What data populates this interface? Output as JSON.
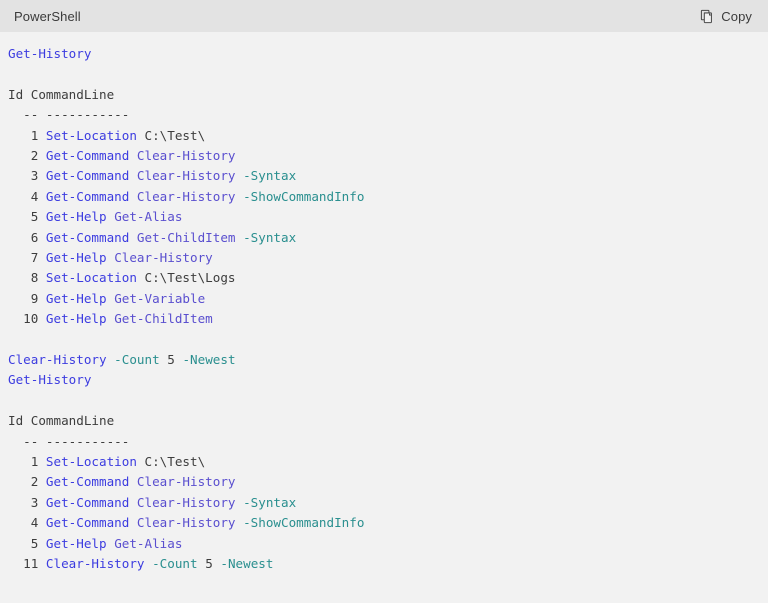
{
  "header": {
    "language_label": "PowerShell",
    "copy_label": "Copy",
    "copy_icon": "copy-pages-icon",
    "background_color": "#e3e3e3"
  },
  "code_block": {
    "background_color": "#f2f2f2",
    "colors": {
      "cmdlet": "#3c3ce0",
      "argument": "#5a4fcf",
      "parameter": "#2a8f8f",
      "plain": "#3d3d3d"
    },
    "lines": [
      {
        "id": "l1",
        "type": "command",
        "tokens": [
          {
            "t": "Get-History",
            "c": "cmdlet"
          }
        ]
      },
      {
        "id": "l2",
        "type": "blank",
        "tokens": []
      },
      {
        "id": "l3",
        "type": "output",
        "tokens": [
          {
            "t": "Id CommandLine",
            "c": "header"
          }
        ]
      },
      {
        "id": "l4",
        "type": "output",
        "tokens": [
          {
            "t": "  -- -----------",
            "c": "rule"
          }
        ]
      },
      {
        "id": "l5",
        "type": "output",
        "tokens": [
          {
            "t": "   1 ",
            "c": "num"
          },
          {
            "t": "Set-Location",
            "c": "cmdlet"
          },
          {
            "t": " ",
            "c": "plain"
          },
          {
            "t": "C:\\Test\\",
            "c": "plain"
          }
        ]
      },
      {
        "id": "l6",
        "type": "output",
        "tokens": [
          {
            "t": "   2 ",
            "c": "num"
          },
          {
            "t": "Get-Command",
            "c": "cmdlet"
          },
          {
            "t": " ",
            "c": "plain"
          },
          {
            "t": "Clear-History",
            "c": "argument"
          }
        ]
      },
      {
        "id": "l7",
        "type": "output",
        "tokens": [
          {
            "t": "   3 ",
            "c": "num"
          },
          {
            "t": "Get-Command",
            "c": "cmdlet"
          },
          {
            "t": " ",
            "c": "plain"
          },
          {
            "t": "Clear-History",
            "c": "argument"
          },
          {
            "t": " ",
            "c": "plain"
          },
          {
            "t": "-Syntax",
            "c": "parameter"
          }
        ]
      },
      {
        "id": "l8",
        "type": "output",
        "tokens": [
          {
            "t": "   4 ",
            "c": "num"
          },
          {
            "t": "Get-Command",
            "c": "cmdlet"
          },
          {
            "t": " ",
            "c": "plain"
          },
          {
            "t": "Clear-History",
            "c": "argument"
          },
          {
            "t": " ",
            "c": "plain"
          },
          {
            "t": "-ShowCommandInfo",
            "c": "parameter"
          }
        ]
      },
      {
        "id": "l9",
        "type": "output",
        "tokens": [
          {
            "t": "   5 ",
            "c": "num"
          },
          {
            "t": "Get-Help",
            "c": "cmdlet"
          },
          {
            "t": " ",
            "c": "plain"
          },
          {
            "t": "Get-Alias",
            "c": "argument"
          }
        ]
      },
      {
        "id": "l10",
        "type": "output",
        "tokens": [
          {
            "t": "   6 ",
            "c": "num"
          },
          {
            "t": "Get-Command",
            "c": "cmdlet"
          },
          {
            "t": " ",
            "c": "plain"
          },
          {
            "t": "Get-ChildItem",
            "c": "argument"
          },
          {
            "t": " ",
            "c": "plain"
          },
          {
            "t": "-Syntax",
            "c": "parameter"
          }
        ]
      },
      {
        "id": "l11",
        "type": "output",
        "tokens": [
          {
            "t": "   7 ",
            "c": "num"
          },
          {
            "t": "Get-Help",
            "c": "cmdlet"
          },
          {
            "t": " ",
            "c": "plain"
          },
          {
            "t": "Clear-History",
            "c": "argument"
          }
        ]
      },
      {
        "id": "l12",
        "type": "output",
        "tokens": [
          {
            "t": "   8 ",
            "c": "num"
          },
          {
            "t": "Set-Location",
            "c": "cmdlet"
          },
          {
            "t": " ",
            "c": "plain"
          },
          {
            "t": "C:\\Test\\Logs",
            "c": "plain"
          }
        ]
      },
      {
        "id": "l13",
        "type": "output",
        "tokens": [
          {
            "t": "   9 ",
            "c": "num"
          },
          {
            "t": "Get-Help",
            "c": "cmdlet"
          },
          {
            "t": " ",
            "c": "plain"
          },
          {
            "t": "Get-Variable",
            "c": "argument"
          }
        ]
      },
      {
        "id": "l14",
        "type": "output",
        "tokens": [
          {
            "t": "  10 ",
            "c": "num"
          },
          {
            "t": "Get-Help",
            "c": "cmdlet"
          },
          {
            "t": " ",
            "c": "plain"
          },
          {
            "t": "Get-ChildItem",
            "c": "argument"
          }
        ]
      },
      {
        "id": "l15",
        "type": "blank",
        "tokens": []
      },
      {
        "id": "l16",
        "type": "command",
        "tokens": [
          {
            "t": "Clear-History",
            "c": "cmdlet"
          },
          {
            "t": " ",
            "c": "plain"
          },
          {
            "t": "-Count",
            "c": "parameter"
          },
          {
            "t": " ",
            "c": "plain"
          },
          {
            "t": "5",
            "c": "num"
          },
          {
            "t": " ",
            "c": "plain"
          },
          {
            "t": "-Newest",
            "c": "parameter"
          }
        ]
      },
      {
        "id": "l17",
        "type": "command",
        "tokens": [
          {
            "t": "Get-History",
            "c": "cmdlet"
          }
        ]
      },
      {
        "id": "l18",
        "type": "blank",
        "tokens": []
      },
      {
        "id": "l19",
        "type": "output",
        "tokens": [
          {
            "t": "Id CommandLine",
            "c": "header"
          }
        ]
      },
      {
        "id": "l20",
        "type": "output",
        "tokens": [
          {
            "t": "  -- -----------",
            "c": "rule"
          }
        ]
      },
      {
        "id": "l21",
        "type": "output",
        "tokens": [
          {
            "t": "   1 ",
            "c": "num"
          },
          {
            "t": "Set-Location",
            "c": "cmdlet"
          },
          {
            "t": " ",
            "c": "plain"
          },
          {
            "t": "C:\\Test\\",
            "c": "plain"
          }
        ]
      },
      {
        "id": "l22",
        "type": "output",
        "tokens": [
          {
            "t": "   2 ",
            "c": "num"
          },
          {
            "t": "Get-Command",
            "c": "cmdlet"
          },
          {
            "t": " ",
            "c": "plain"
          },
          {
            "t": "Clear-History",
            "c": "argument"
          }
        ]
      },
      {
        "id": "l23",
        "type": "output",
        "tokens": [
          {
            "t": "   3 ",
            "c": "num"
          },
          {
            "t": "Get-Command",
            "c": "cmdlet"
          },
          {
            "t": " ",
            "c": "plain"
          },
          {
            "t": "Clear-History",
            "c": "argument"
          },
          {
            "t": " ",
            "c": "plain"
          },
          {
            "t": "-Syntax",
            "c": "parameter"
          }
        ]
      },
      {
        "id": "l24",
        "type": "output",
        "tokens": [
          {
            "t": "   4 ",
            "c": "num"
          },
          {
            "t": "Get-Command",
            "c": "cmdlet"
          },
          {
            "t": " ",
            "c": "plain"
          },
          {
            "t": "Clear-History",
            "c": "argument"
          },
          {
            "t": " ",
            "c": "plain"
          },
          {
            "t": "-ShowCommandInfo",
            "c": "parameter"
          }
        ]
      },
      {
        "id": "l25",
        "type": "output",
        "tokens": [
          {
            "t": "   5 ",
            "c": "num"
          },
          {
            "t": "Get-Help",
            "c": "cmdlet"
          },
          {
            "t": " ",
            "c": "plain"
          },
          {
            "t": "Get-Alias",
            "c": "argument"
          }
        ]
      },
      {
        "id": "l26",
        "type": "output",
        "tokens": [
          {
            "t": "  11 ",
            "c": "num"
          },
          {
            "t": "Clear-History",
            "c": "cmdlet"
          },
          {
            "t": " ",
            "c": "plain"
          },
          {
            "t": "-Count",
            "c": "parameter"
          },
          {
            "t": " ",
            "c": "plain"
          },
          {
            "t": "5",
            "c": "num"
          },
          {
            "t": " ",
            "c": "plain"
          },
          {
            "t": "-Newest",
            "c": "parameter"
          }
        ]
      }
    ]
  }
}
